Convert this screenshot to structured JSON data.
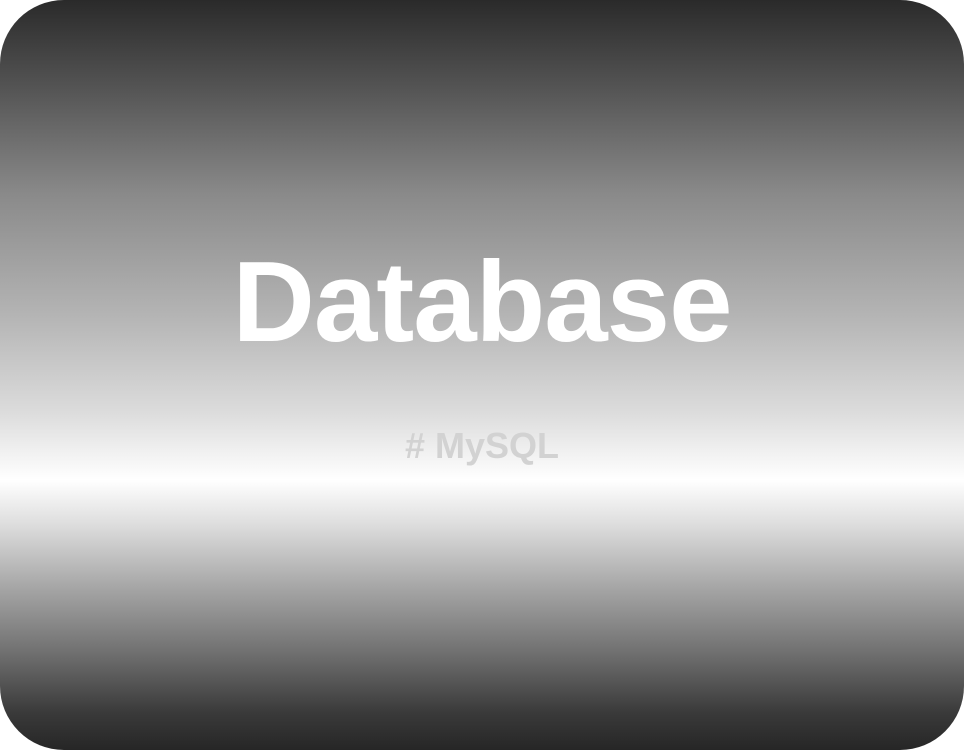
{
  "card": {
    "title": "Database",
    "tag": "# MySQL"
  }
}
